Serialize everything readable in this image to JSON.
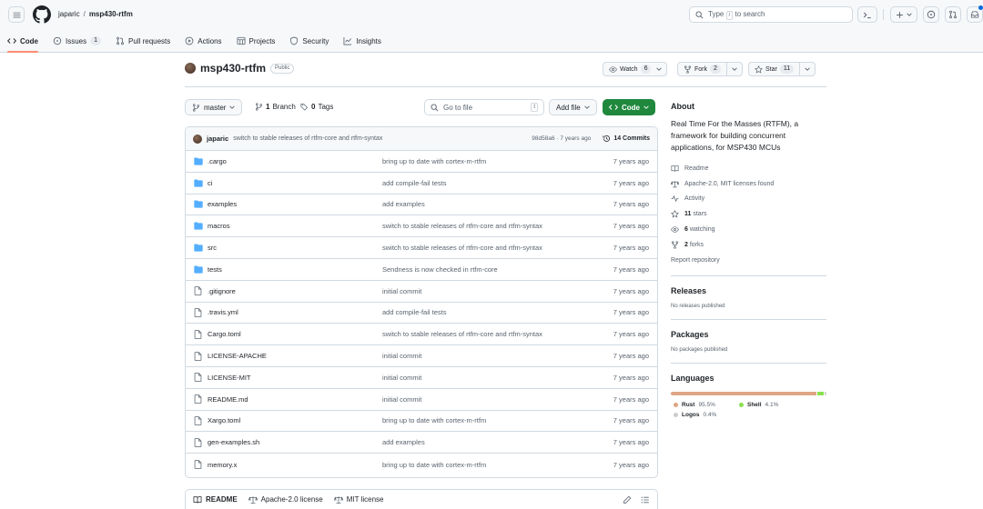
{
  "header": {
    "owner": "japaric",
    "separator": "/",
    "repo": "msp430-rtfm",
    "search_text": "Type",
    "search_key": "/",
    "search_suffix": "to search"
  },
  "nav_tabs": [
    {
      "label": "Code",
      "counter": ""
    },
    {
      "label": "Issues",
      "counter": "1"
    },
    {
      "label": "Pull requests",
      "counter": ""
    },
    {
      "label": "Actions",
      "counter": ""
    },
    {
      "label": "Projects",
      "counter": ""
    },
    {
      "label": "Security",
      "counter": ""
    },
    {
      "label": "Insights",
      "counter": ""
    }
  ],
  "repo": {
    "name": "msp430-rtfm",
    "visibility": "Public",
    "watch_label": "Watch",
    "watch_count": "6",
    "fork_label": "Fork",
    "fork_count": "2",
    "star_label": "Star",
    "star_count": "11"
  },
  "toolbar": {
    "branch": "master",
    "branch_count": "1",
    "branch_label": "Branch",
    "tag_count": "0",
    "tag_label": "Tags",
    "go_to_file": "Go to file",
    "go_to_file_key": "t",
    "add_file": "Add file",
    "code": "Code"
  },
  "latest_commit": {
    "author": "japaric",
    "message": "switch to stable releases of rtfm-core and rtfm-syntax",
    "hash_time": "98d58a6 · 7 years ago",
    "commits": "14 Commits"
  },
  "files": [
    {
      "type": "dir",
      "name": ".cargo",
      "message": "bring up to date with cortex-m-rtfm",
      "age": "7 years ago"
    },
    {
      "type": "dir",
      "name": "ci",
      "message": "add compile-fail tests",
      "age": "7 years ago"
    },
    {
      "type": "dir",
      "name": "examples",
      "message": "add examples",
      "age": "7 years ago"
    },
    {
      "type": "dir",
      "name": "macros",
      "message": "switch to stable releases of rtfm-core and rtfm-syntax",
      "age": "7 years ago"
    },
    {
      "type": "dir",
      "name": "src",
      "message": "switch to stable releases of rtfm-core and rtfm-syntax",
      "age": "7 years ago"
    },
    {
      "type": "dir",
      "name": "tests",
      "message": "Sendness is now checked in rtfm-core",
      "age": "7 years ago"
    },
    {
      "type": "file",
      "name": ".gitignore",
      "message": "initial commit",
      "age": "7 years ago"
    },
    {
      "type": "file",
      "name": ".travis.yml",
      "message": "add compile-fail tests",
      "age": "7 years ago"
    },
    {
      "type": "file",
      "name": "Cargo.toml",
      "message": "switch to stable releases of rtfm-core and rtfm-syntax",
      "age": "7 years ago"
    },
    {
      "type": "file",
      "name": "LICENSE-APACHE",
      "message": "initial commit",
      "age": "7 years ago"
    },
    {
      "type": "file",
      "name": "LICENSE-MIT",
      "message": "initial commit",
      "age": "7 years ago"
    },
    {
      "type": "file",
      "name": "README.md",
      "message": "initial commit",
      "age": "7 years ago"
    },
    {
      "type": "file",
      "name": "Xargo.toml",
      "message": "bring up to date with cortex-m-rtfm",
      "age": "7 years ago"
    },
    {
      "type": "file",
      "name": "gen-examples.sh",
      "message": "add examples",
      "age": "7 years ago"
    },
    {
      "type": "file",
      "name": "memory.x",
      "message": "bring up to date with cortex-m-rtfm",
      "age": "7 years ago"
    }
  ],
  "readme_tabs": [
    {
      "label": "README",
      "icon": "book-icon"
    },
    {
      "label": "Apache-2.0 license",
      "icon": "scale-icon"
    },
    {
      "label": "MIT license",
      "icon": "scale-icon"
    }
  ],
  "about": {
    "title": "About",
    "description": "Real Time For the Masses (RTFM), a framework for building concurrent applications, for MSP430 MCUs",
    "readme": "Readme",
    "license": "Apache-2.0, MIT licenses found",
    "activity": "Activity",
    "stars_count": "11",
    "stars_label": "stars",
    "watching_count": "6",
    "watching_label": "watching",
    "forks_count": "2",
    "forks_label": "forks",
    "report": "Report repository"
  },
  "releases": {
    "title": "Releases",
    "empty": "No releases published"
  },
  "packages": {
    "title": "Packages",
    "empty": "No packages published"
  },
  "languages": {
    "title": "Languages",
    "items": [
      {
        "name": "Rust",
        "percent": "95.5%",
        "share": 95.5,
        "color": "#dea584"
      },
      {
        "name": "Shell",
        "percent": "4.1%",
        "share": 4.1,
        "color": "#89e051"
      },
      {
        "name": "Logos",
        "percent": "0.4%",
        "share": 0.4,
        "color": "#cccccc"
      }
    ]
  },
  "colors": {
    "accent_underline": "#fd8c73",
    "code_button": "#1f883d",
    "folder": "#54aeff"
  }
}
